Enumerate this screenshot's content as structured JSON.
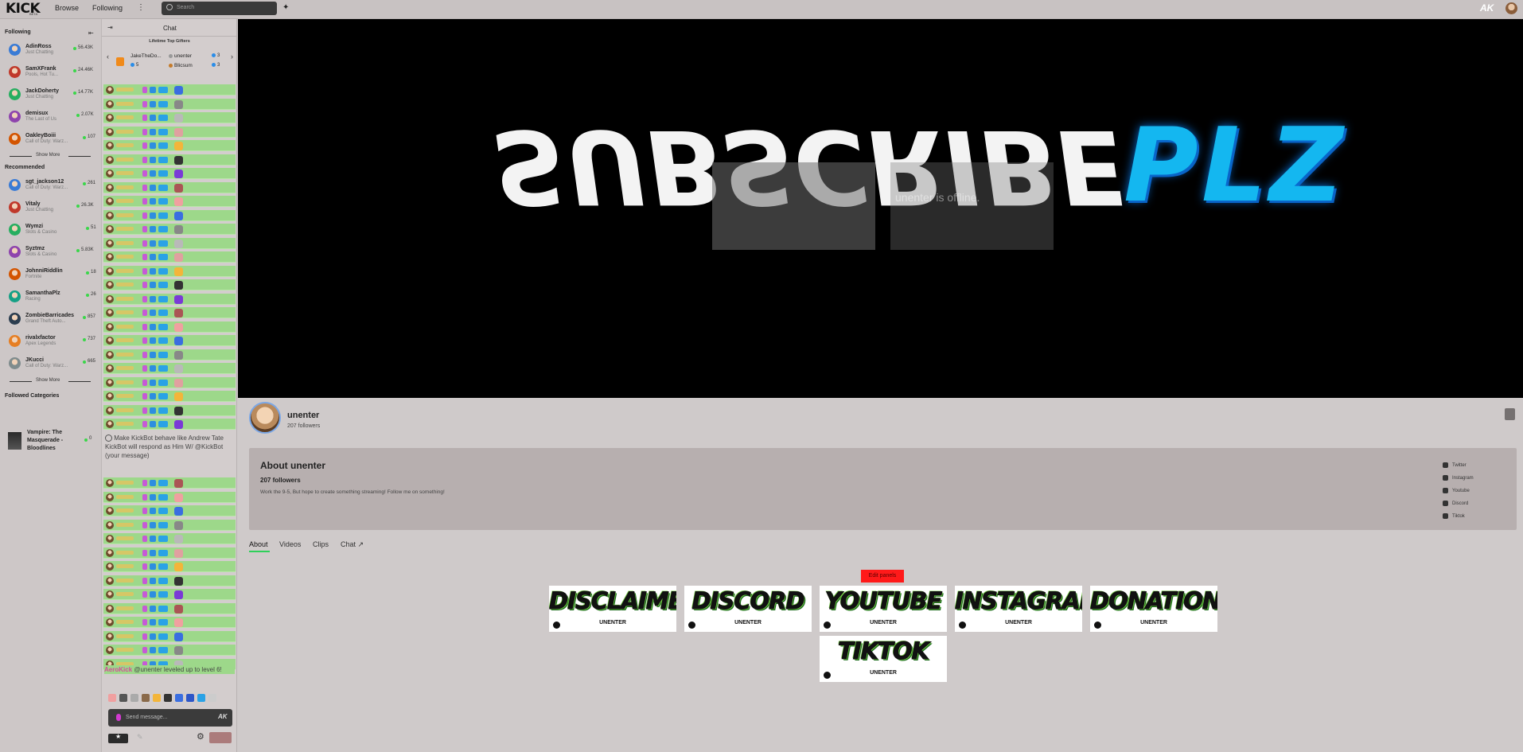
{
  "topbar": {
    "logo": "KICK",
    "logo_sub": "BETA",
    "nav": [
      "Browse",
      "Following"
    ],
    "search_placeholder": "Search"
  },
  "sidebar": {
    "following_title": "Following",
    "following": [
      {
        "name": "AdinRoss",
        "category": "Just Chatting",
        "viewers": "56.43K"
      },
      {
        "name": "SamXFrank",
        "category": "Pools, Hot Tu...",
        "viewers": "24.46K"
      },
      {
        "name": "JackDoherty",
        "category": "Just Chatting",
        "viewers": "14.77K"
      },
      {
        "name": "demisux",
        "category": "The Last of Us",
        "viewers": "2.07K"
      },
      {
        "name": "OakleyBoiii",
        "category": "Call of Duty: Warz...",
        "viewers": "107"
      }
    ],
    "show_more": "Show More",
    "recommended_title": "Recommended",
    "recommended": [
      {
        "name": "sgt_jackson12",
        "category": "Call of Duty: Warz...",
        "viewers": "261"
      },
      {
        "name": "Vitaly",
        "category": "Just Chatting",
        "viewers": "26.3K"
      },
      {
        "name": "Wymzi",
        "category": "Slots & Casino",
        "viewers": "51"
      },
      {
        "name": "Syztmz",
        "category": "Slots & Casino",
        "viewers": "5.83K"
      },
      {
        "name": "JohnniRiddlin",
        "category": "Fortnite",
        "viewers": "18"
      },
      {
        "name": "SamanthaPlz",
        "category": "Racing",
        "viewers": "26"
      },
      {
        "name": "ZombieBarricades",
        "category": "Grand Theft Auto...",
        "viewers": "857"
      },
      {
        "name": "rivalxfactor",
        "category": "Apex Legends",
        "viewers": "737"
      },
      {
        "name": "JKucci",
        "category": "Call of Duty: Warz...",
        "viewers": "665"
      }
    ],
    "followed_categories_title": "Followed Categories",
    "followed_category": {
      "name": "Vampire: The Masquerade - Bloodlines",
      "viewers": "0"
    }
  },
  "chat": {
    "title": "Chat",
    "gifters_title": "Lifetime Top Gifters",
    "gifters": [
      {
        "name": "JakeTheDo...",
        "count": "5"
      },
      {
        "name": "unenter",
        "count": "3"
      },
      {
        "name": "Blicsum",
        "count": "3"
      }
    ],
    "kickbot_message": "Make KickBot behave like Andrew Tate KickBot will respond as Him W/ @KickBot (your message)",
    "aero_name": "AeroKick",
    "aero_message": "@unenter leveled up to level 6!",
    "send_placeholder": "Send message..."
  },
  "player": {
    "title_mirrored": "SUBSCRIBE",
    "title_accent": "PLZ",
    "overlay_text": "unenter is offline."
  },
  "channel": {
    "name": "unenter",
    "followers": "207 followers"
  },
  "about": {
    "title": "About unenter",
    "followers": "207 followers",
    "bio": "Work the 9-5, But hope to create something streaming! Follow me on something!",
    "socials": [
      "Twitter",
      "Instagram",
      "Youtube",
      "Discord",
      "Tiktok"
    ]
  },
  "tabs": [
    "About",
    "Videos",
    "Clips",
    "Chat ↗"
  ],
  "panels": {
    "edit_label": "Edit panels",
    "items": [
      {
        "title": "DISCLAIMERS",
        "sub": "UNENTER"
      },
      {
        "title": "DISCORD",
        "sub": "UNENTER"
      },
      {
        "title": "YOUTUBE",
        "sub": "UNENTER"
      },
      {
        "title": "INSTAGRAM",
        "sub": "UNENTER"
      },
      {
        "title": "DONATIONS",
        "sub": "UNENTER"
      },
      {
        "title": "TIKTOK",
        "sub": "UNENTER"
      }
    ]
  },
  "colors": {
    "accent": "#53fc18",
    "chat_row": "#9dd88a",
    "edit_button": "#ff1a1a",
    "player_accent": "#14b7f0"
  }
}
